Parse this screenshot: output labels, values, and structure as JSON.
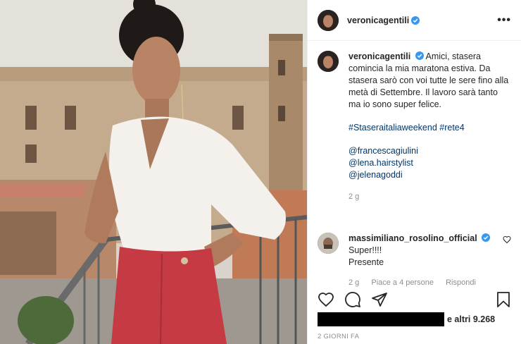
{
  "header": {
    "username": "veronicagentili",
    "more_label": "•••"
  },
  "caption": {
    "username": "veronicagentili",
    "text": "Amici, stasera comincia la mia maratona estiva. Da stasera sarò con voi tutte le sere fino alla metà di Settembre. Il lavoro sarà tanto ma io sono super felice.",
    "hashtags": "#Staseraitaliaweekend #rete4",
    "mentions": [
      "@francescagiulini",
      "@lena.hairstylist",
      "@jelenagoddi"
    ],
    "age": "2 g"
  },
  "comment": {
    "username": "massimiliano_rosolino_official",
    "line1": "Super!!!!",
    "line2": "Presente",
    "age": "2 g",
    "likes": "Piace a 4 persone",
    "reply_label": "Rispondi"
  },
  "likes": {
    "text": "e altri 9.268"
  },
  "timestamp": "2 GIORNI FA",
  "colors": {
    "verified": "#3897f0",
    "link": "#00376b",
    "muted": "#8e8e8e"
  },
  "icons": [
    "heart-icon",
    "comment-icon",
    "share-icon",
    "bookmark-icon",
    "verified-badge-icon",
    "more-icon"
  ]
}
